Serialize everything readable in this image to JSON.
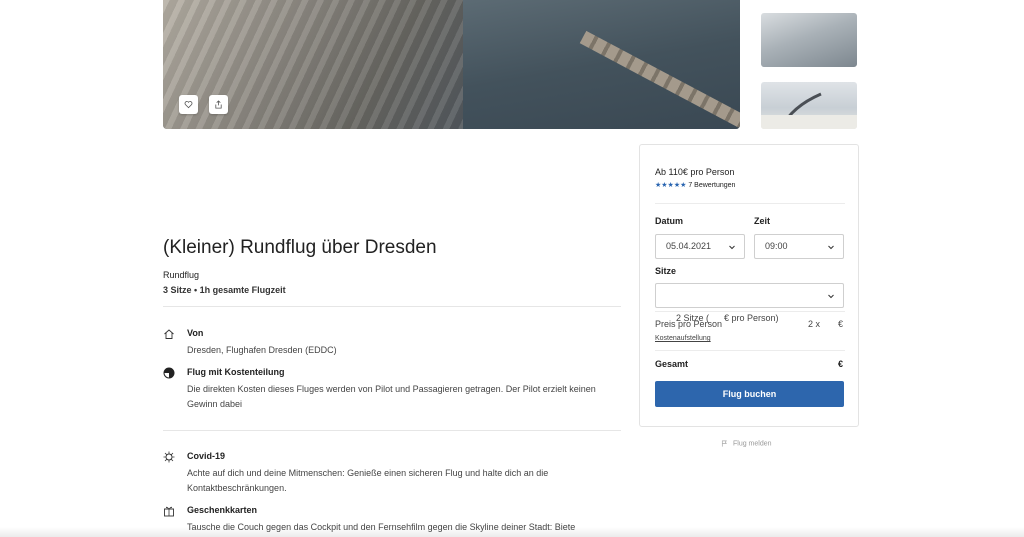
{
  "gallery": {
    "favorite_icon": "heart-icon",
    "share_icon": "share-icon"
  },
  "listing": {
    "title": "(Kleiner) Rundflug über Dresden",
    "category": "Rundflug",
    "summary": "3 Sitze • 1h gesamte Flugzeit"
  },
  "features": [
    {
      "icon": "home-icon",
      "heading": "Von",
      "text": "Dresden, Flughafen Dresden (EDDC)"
    },
    {
      "icon": "half-circle-icon",
      "heading": "Flug mit Kostenteilung",
      "text": "Die direkten Kosten dieses Fluges werden von Pilot und Passagieren getragen. Der Pilot erzielt keinen Gewinn dabei"
    },
    {
      "icon": "virus-icon",
      "heading": "Covid-19",
      "text": "Achte auf dich und deine Mitmenschen: Genieße einen sicheren Flug und halte dich an die Kontaktbeschränkungen."
    },
    {
      "icon": "gift-icon",
      "heading": "Geschenkkarten",
      "text": "Tausche die Couch gegen das Cockpit und den Fernsehfilm gegen die Skyline deiner Stadt: Biete"
    }
  ],
  "booking": {
    "price": "Ab 110€ pro Person",
    "stars": "★★★★★",
    "rating": 5,
    "reviews": "7 Bewertungen",
    "date_label": "Datum",
    "date_value": "05.04.2021",
    "time_label": "Zeit",
    "time_value": "09:00",
    "seats_label": "Sitze",
    "seats_value": "2 Sitze (      € pro Person)",
    "price_per_person_label": "Preis pro Person",
    "price_per_person_qty": "2 x",
    "price_per_person_value": "€",
    "cost_breakdown_link": "Kostenaufstellung",
    "total_label": "Gesamt",
    "total_value": "€",
    "book_button": "Flug buchen",
    "accent_color": "#2d66ad"
  },
  "report": {
    "label": "Flug melden",
    "icon": "flag-icon"
  }
}
